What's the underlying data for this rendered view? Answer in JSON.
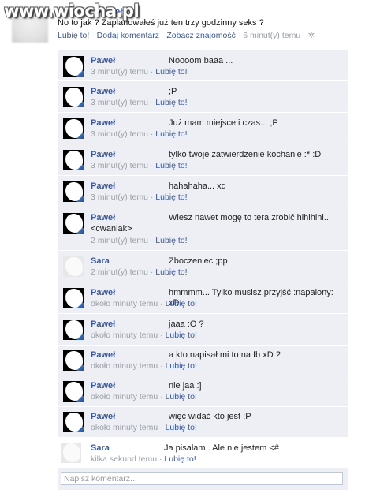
{
  "watermark": "www.wiocha.pl",
  "story": {
    "author": "Paweł",
    "text": "No to jak ? Zaplanowałeś już ten trzy godzinny seks ?",
    "like": "Lubię to!",
    "add_comment": "Dodaj komentarz",
    "see_friendship": "Zobacz znajomość",
    "time": "6 minut(y) temu"
  },
  "comments": [
    {
      "author": "Paweł",
      "text": "Noooom baaa ...",
      "time": "3 minut(y) temu",
      "like": "Lubię to!"
    },
    {
      "author": "Paweł",
      "text": ";P",
      "time": "3 minut(y) temu",
      "like": "Lubię to!"
    },
    {
      "author": "Paweł",
      "text": "Już mam miejsce i czas... ;P",
      "time": "3 minut(y) temu",
      "like": "Lubię to!"
    },
    {
      "author": "Paweł",
      "text": "tylko twoje zatwierdzenie kochanie :* :D",
      "time": "3 minut(y) temu",
      "like": "Lubię to!"
    },
    {
      "author": "Paweł",
      "text": "hahahaha... xd",
      "time": "3 minut(y) temu",
      "like": "Lubię to!"
    },
    {
      "author": "Paweł",
      "text": "Wiesz nawet mogę to tera zrobić hihihihi...",
      "text2": "<cwaniak>",
      "time": "2 minut(y) temu",
      "like": "Lubię to!"
    },
    {
      "author": "Sara",
      "text": "Zboczeniec ;pp",
      "time": "2 minut(y) temu",
      "like": "Lubię to!"
    },
    {
      "author": "Paweł",
      "text": "hmmmm... Tylko musisz przyjść :napalony: xD",
      "time": "około minuty temu",
      "like": "Lubię to!"
    },
    {
      "author": "Paweł",
      "text": "jaaa :O ?",
      "time": "około minuty temu",
      "like": "Lubię to!"
    },
    {
      "author": "Paweł",
      "text": "a kto napisał mi to na fb xD ?",
      "time": "około minuty temu",
      "like": "Lubię to!"
    },
    {
      "author": "Paweł",
      "text": "nie jaa :]",
      "time": "około minuty temu",
      "like": "Lubię to!"
    },
    {
      "author": "Paweł",
      "text": "więc widać kto jest ;P",
      "time": "około minuty temu",
      "like": "Lubię to!"
    },
    {
      "author": "Sara",
      "text": "Ja pisałam . Ale nie jestem <#",
      "time": "kilka sekund temu",
      "like": "Lubię to!"
    }
  ],
  "compose": {
    "placeholder": "Napisz komentarz..."
  }
}
